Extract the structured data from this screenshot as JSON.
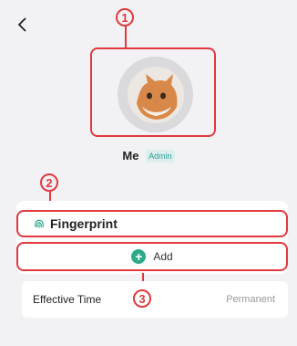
{
  "user": {
    "name": "Me",
    "role_badge": "Admin"
  },
  "credential": {
    "label": "Fingerprint",
    "add_label": "Add"
  },
  "effective_time": {
    "label": "Effective Time",
    "value": "Permanent"
  },
  "markers": [
    "1",
    "2",
    "3"
  ],
  "colors": {
    "highlight": "#e0393e",
    "accent": "#2aaa8a",
    "badge_bg": "#dcefee"
  },
  "icons": {
    "back": "chevron-left-icon",
    "fingerprint": "fingerprint-icon",
    "add": "plus-circle-icon"
  }
}
